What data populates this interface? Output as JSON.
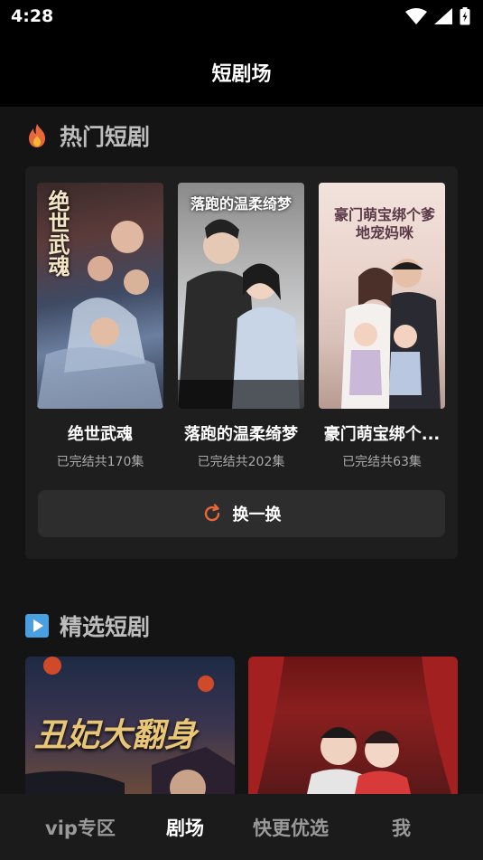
{
  "status": {
    "time": "4:28"
  },
  "header": {
    "title": "短剧场"
  },
  "hot": {
    "title": "热门短剧",
    "items": [
      {
        "title": "绝世武魂",
        "subtitle": "已完结共170集",
        "poster_text": "绝世武魂"
      },
      {
        "title": "落跑的温柔绮梦",
        "subtitle": "已完结共202集",
        "poster_text": "落跑的温柔绮梦"
      },
      {
        "title": "豪门萌宝绑个...",
        "subtitle": "已完结共63集",
        "poster_text": "豪门萌宝绑个爹地宠妈咪"
      }
    ],
    "refresh_label": "换一换"
  },
  "featured": {
    "title": "精选短剧",
    "items": [
      {
        "poster_text": "丑妃大翻身"
      },
      {
        "poster_text": ""
      }
    ]
  },
  "nav": {
    "items": [
      "vip专区",
      "剧场",
      "快更优选",
      "我"
    ],
    "active": "剧场"
  },
  "colors": {
    "accent": "#e8673b",
    "background": "#141414",
    "card": "#1e1e1e"
  }
}
